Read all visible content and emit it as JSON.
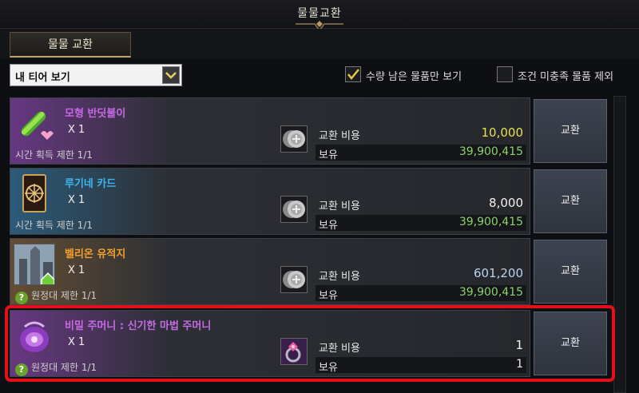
{
  "window": {
    "title": "물물교환"
  },
  "tabs": [
    {
      "label": "물물 교환"
    }
  ],
  "filters": {
    "tier_select": {
      "value": "내 티어 보기"
    },
    "only_remaining": {
      "label": "수량 남은 물품만 보기",
      "checked": true
    },
    "exclude_unmet": {
      "label": "조건 미충족 물품 제외",
      "checked": false
    }
  },
  "items": [
    {
      "name": "모형 반딧불이",
      "name_color": "#c76ae6",
      "quantity": "X 1",
      "limit": "시간 획득 제한 1/1",
      "limit_icon": "",
      "cost_label": "교환 비용",
      "cost": "10,000",
      "cost_color": "#e8e050",
      "have_label": "보유",
      "have": "39,900,415",
      "have_color": "#8cd26a",
      "currency_icon": "silver-coin-icon",
      "button": "교환"
    },
    {
      "name": "루기네 카드",
      "name_color": "#3fb4f0",
      "quantity": "X 1",
      "limit": "시간 획득 제한 1/1",
      "limit_icon": "",
      "cost_label": "교환 비용",
      "cost": "8,000",
      "cost_color": "#f2f2f2",
      "have_label": "보유",
      "have": "39,900,415",
      "have_color": "#8cd26a",
      "currency_icon": "silver-coin-icon",
      "button": "교환"
    },
    {
      "name": "벨리온 유적지",
      "name_color": "#f0a030",
      "quantity": "X 1",
      "limit": "원정대 제한 1/1",
      "limit_icon": "?",
      "cost_label": "교환 비용",
      "cost": "601,200",
      "cost_color": "#b9d3f0",
      "have_label": "보유",
      "have": "39,900,415",
      "have_color": "#8cd26a",
      "currency_icon": "silver-coin-icon",
      "button": "교환"
    },
    {
      "name": "비밀 주머니 : 신기한 마법 주머니",
      "name_color": "#c76ae6",
      "quantity": "X 1",
      "limit": "원정대 제한 1/1",
      "limit_icon": "?",
      "cost_label": "교환 비용",
      "cost": "1",
      "cost_color": "#f2f2f2",
      "have_label": "보유",
      "have": "1",
      "have_color": "#f2f2f2",
      "currency_icon": "gem-ring-icon",
      "button": "교환"
    }
  ]
}
